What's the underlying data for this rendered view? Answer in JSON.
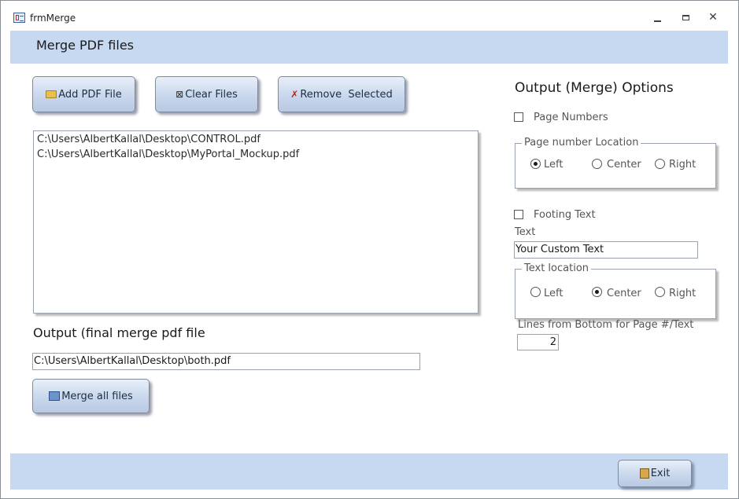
{
  "window": {
    "title": "frmMerge",
    "controls": {
      "minimize": "minimize-icon",
      "maximize": "maximize-icon",
      "close": "✕"
    }
  },
  "header": {
    "title": "Merge PDF files"
  },
  "toolbar": {
    "add_label": "Add PDF File",
    "clear_label": "Clear Files",
    "remove_label": "Remove  Selected"
  },
  "file_list": {
    "items": [
      "C:\\Users\\AlbertKallal\\Desktop\\CONTROL.pdf",
      "C:\\Users\\AlbertKallal\\Desktop\\MyPortal_Mockup.pdf"
    ]
  },
  "output": {
    "label": "Output (final merge pdf file",
    "value": "C:\\Users\\AlbertKallal\\Desktop\\both.pdf",
    "merge_label": "Merge all files"
  },
  "options": {
    "title": "Output (Merge) Options",
    "page_numbers": {
      "label": "Page Numbers",
      "checked": false
    },
    "page_location": {
      "legend": "Page number Location",
      "options": [
        "Left",
        "Center",
        "Right"
      ],
      "selected": "Left"
    },
    "footing_text": {
      "label": "Footing Text",
      "checked": false
    },
    "text_label": "Text",
    "text_value": "Your Custom Text",
    "text_location": {
      "legend": "Text location",
      "options": [
        "Left",
        "Center",
        "Right"
      ],
      "selected": "Center"
    },
    "lines_label": "Lines from Bottom for Page #/Text",
    "lines_value": "2"
  },
  "footer": {
    "exit_label": "Exit"
  },
  "colors": {
    "band": "#c6d9f1",
    "button_top": "#e8eff9",
    "button_bottom": "#b9c9e2"
  }
}
